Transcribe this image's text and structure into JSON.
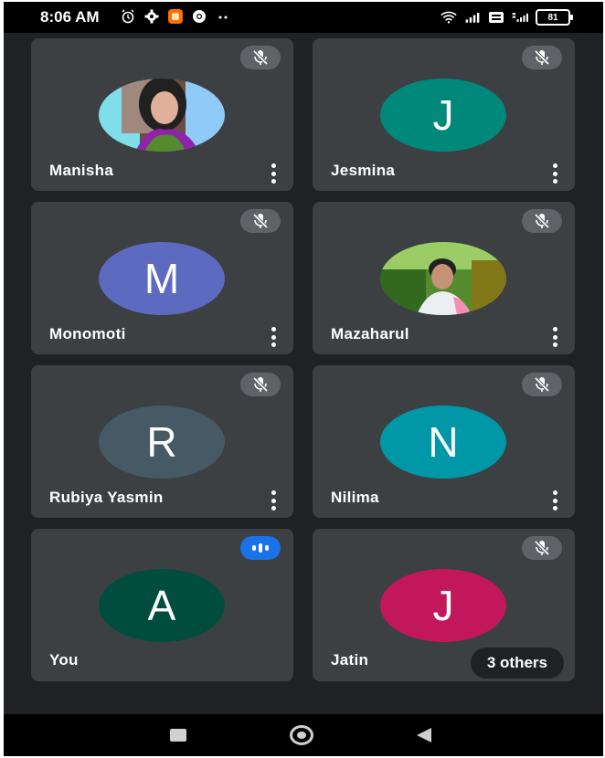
{
  "status_bar": {
    "time": "8:06 AM",
    "battery": "81"
  },
  "participants": [
    {
      "name": "Manisha",
      "initial": "",
      "color": "",
      "photo": true,
      "muted": true,
      "menu": true
    },
    {
      "name": "Jesmina",
      "initial": "J",
      "color": "#00897b",
      "photo": false,
      "muted": true,
      "menu": true
    },
    {
      "name": "Monomoti",
      "initial": "M",
      "color": "#5c6bc0",
      "photo": false,
      "muted": true,
      "menu": true
    },
    {
      "name": "Mazaharul",
      "initial": "",
      "color": "",
      "photo": true,
      "muted": true,
      "menu": true
    },
    {
      "name": "Rubiya Yasmin",
      "initial": "R",
      "color": "#455a64",
      "photo": false,
      "muted": true,
      "menu": true
    },
    {
      "name": "Nilima",
      "initial": "N",
      "color": "#0097a7",
      "photo": false,
      "muted": true,
      "menu": true
    },
    {
      "name": "You",
      "initial": "A",
      "color": "#004d40",
      "photo": false,
      "muted": false,
      "menu": false
    },
    {
      "name": "Jatin",
      "initial": "J",
      "color": "#c2185b",
      "photo": false,
      "muted": true,
      "menu": false
    }
  ],
  "others_label": "3 others",
  "colors": {
    "background": "#202124",
    "tile": "#3c4043",
    "speaking_badge": "#1a73e8"
  }
}
